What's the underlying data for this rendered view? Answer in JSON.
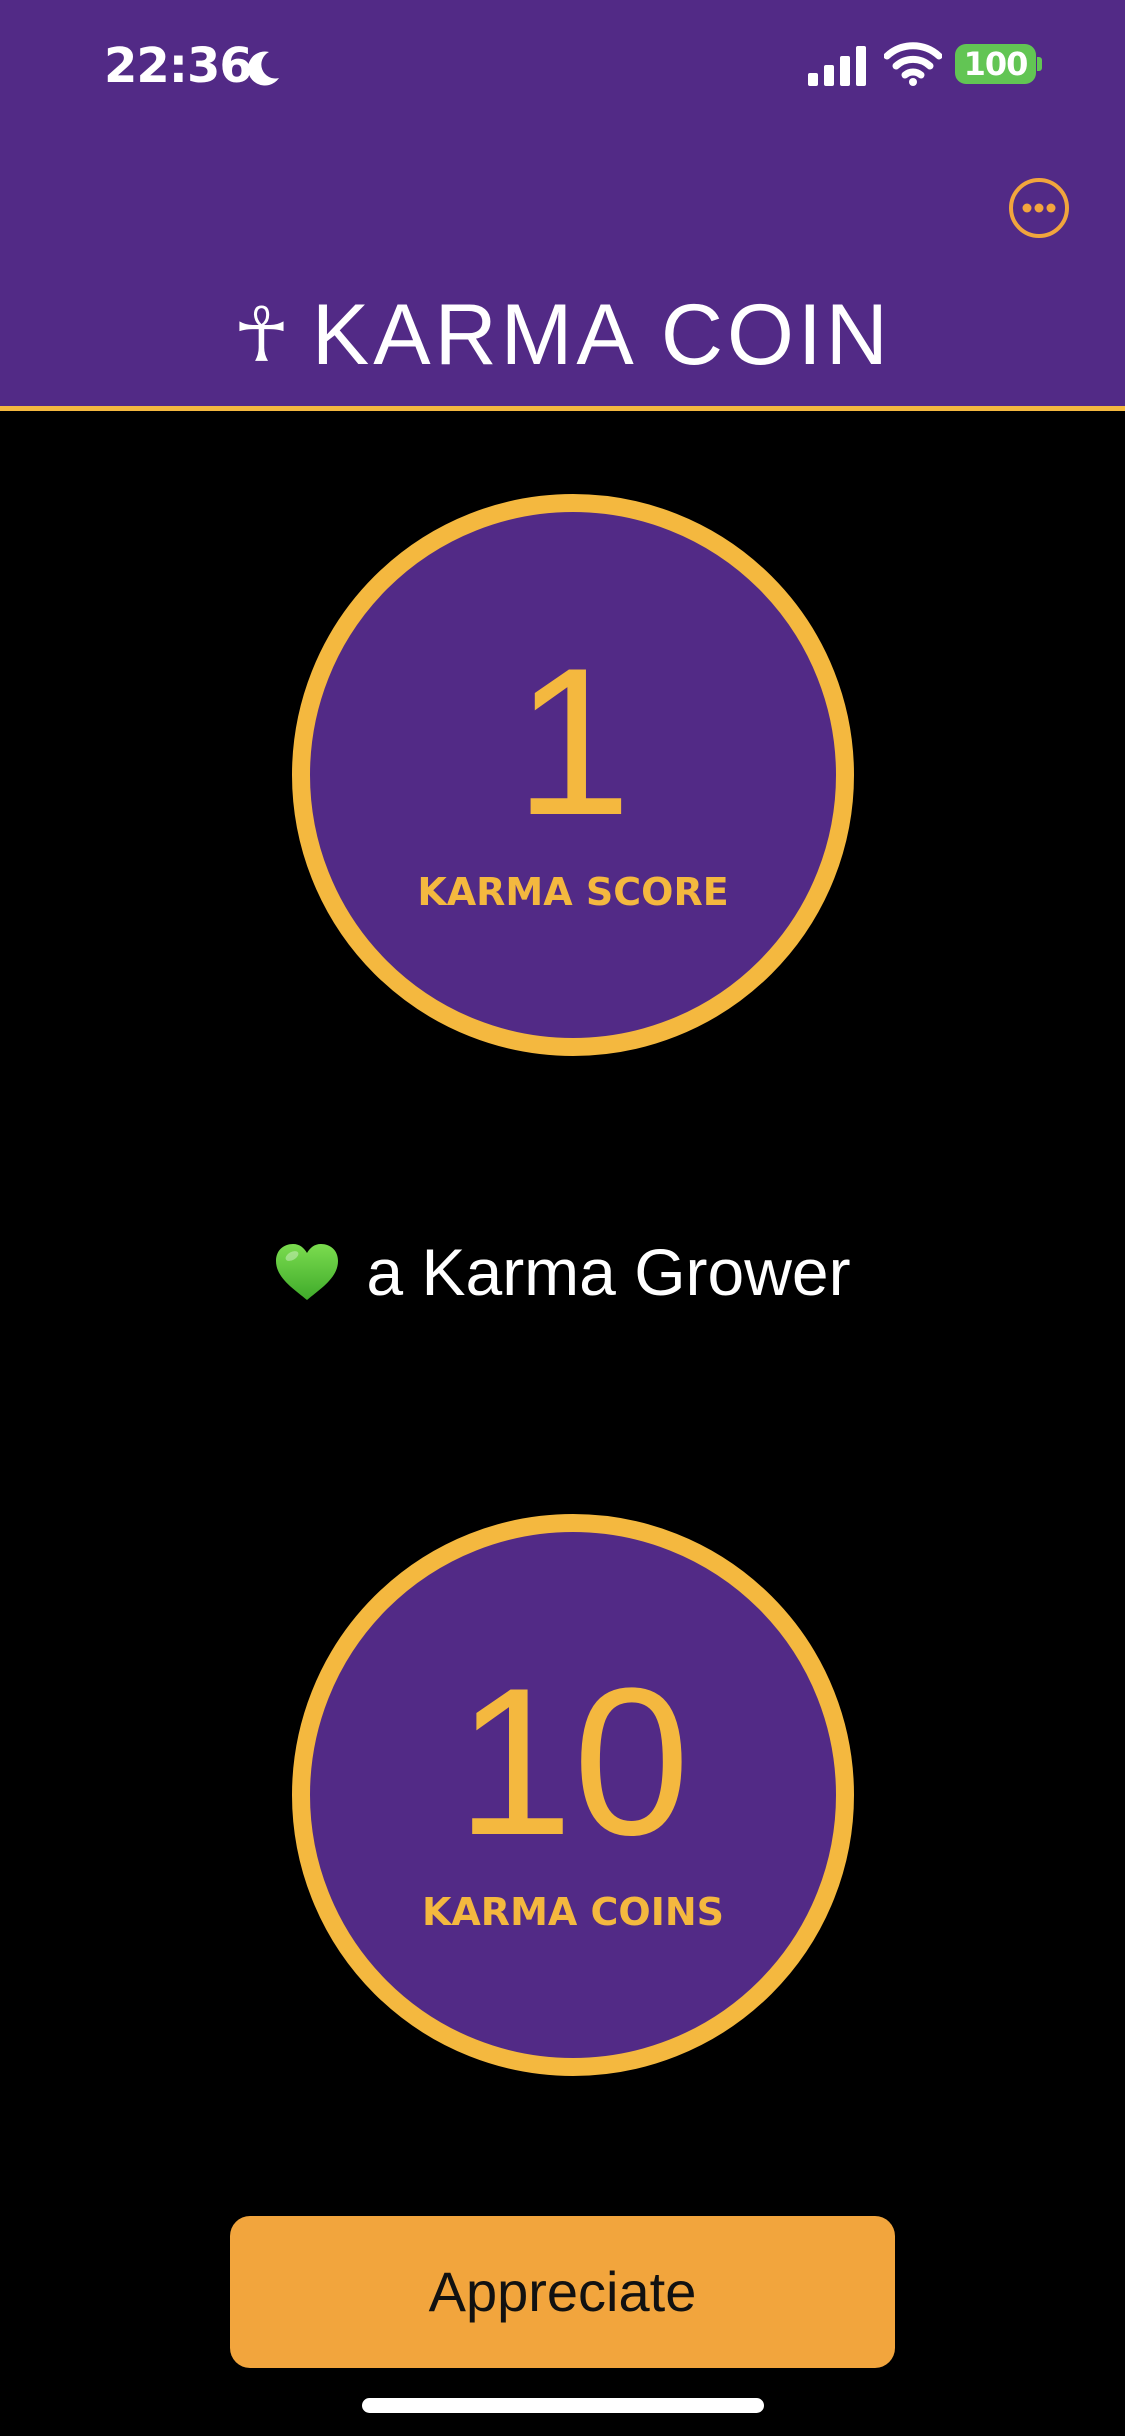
{
  "status_bar": {
    "time": "22:36",
    "battery": "100",
    "icons": [
      "moon-icon",
      "signal-icon",
      "wifi-icon",
      "battery-icon"
    ]
  },
  "header": {
    "title_glyph": "☥",
    "title": "KARMA COIN",
    "menu_icon": "ellipsis-circle-icon"
  },
  "karma_score": {
    "value": "1",
    "label": "KARMA SCORE"
  },
  "rank": {
    "icon": "green-heart-icon",
    "text": "a Karma Grower"
  },
  "karma_coins": {
    "value": "10",
    "label": "KARMA COINS"
  },
  "actions": {
    "appreciate_label": "Appreciate"
  },
  "colors": {
    "header_background": "#522a86",
    "accent": "#f4b83f",
    "button": "#f2a53d",
    "background": "#000000",
    "battery": "#62c554",
    "heart": "#5fc83a"
  }
}
